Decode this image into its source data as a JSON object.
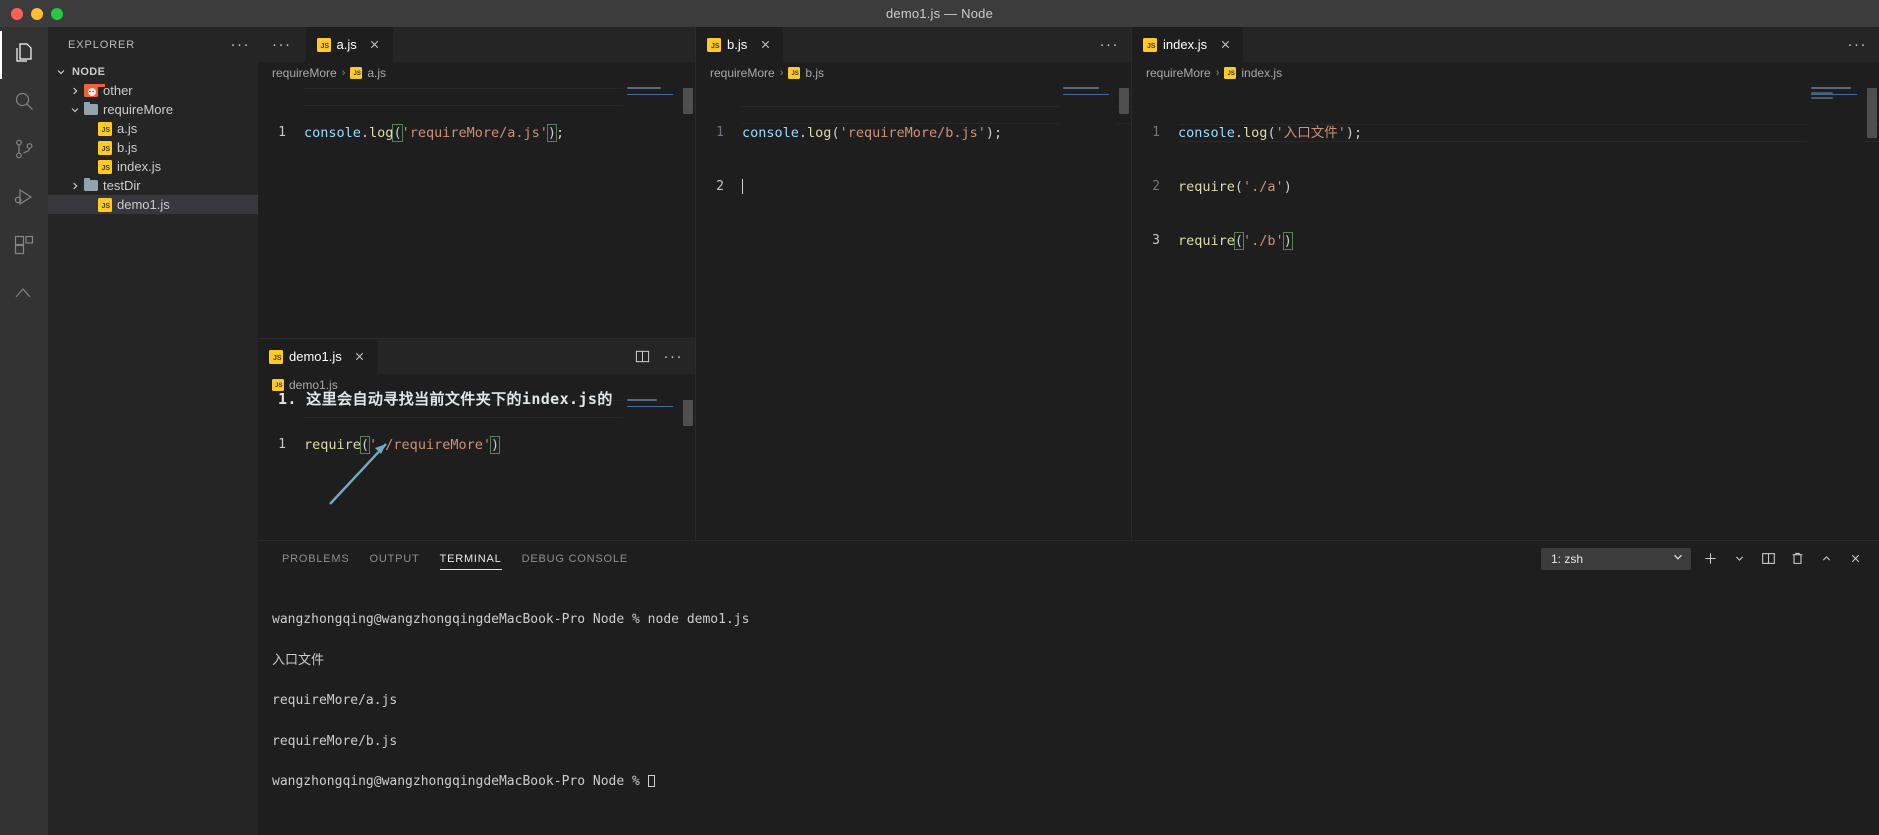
{
  "window": {
    "title": "demo1.js — Node",
    "traffic_lights": [
      "close",
      "minimize",
      "zoom"
    ]
  },
  "activity_bar": {
    "items": [
      {
        "name": "explorer",
        "icon": "files-icon",
        "active": true
      },
      {
        "name": "search",
        "icon": "search-icon",
        "active": false
      },
      {
        "name": "source-control",
        "icon": "source-control-icon",
        "active": false
      },
      {
        "name": "run-and-debug",
        "icon": "run-debug-icon",
        "active": false
      },
      {
        "name": "extensions",
        "icon": "extensions-icon",
        "active": false
      },
      {
        "name": "remote-explorer",
        "icon": "remote-icon",
        "active": false
      }
    ]
  },
  "sidebar": {
    "header": {
      "title": "EXPLORER",
      "more_actions": "···"
    },
    "tree": [
      {
        "label": "NODE",
        "type": "root",
        "expanded": true,
        "indent": 0,
        "icon": "chevron-down-icon"
      },
      {
        "label": "other",
        "type": "folder",
        "expanded": false,
        "indent": 1,
        "icon": "folder-red-icon"
      },
      {
        "label": "requireMore",
        "type": "folder",
        "expanded": true,
        "indent": 1,
        "icon": "folder-blue-icon"
      },
      {
        "label": "a.js",
        "type": "file",
        "indent": 2,
        "icon": "js-file-icon"
      },
      {
        "label": "b.js",
        "type": "file",
        "indent": 2,
        "icon": "js-file-icon"
      },
      {
        "label": "index.js",
        "type": "file",
        "indent": 2,
        "icon": "js-file-icon"
      },
      {
        "label": "testDir",
        "type": "folder",
        "expanded": false,
        "indent": 1,
        "icon": "folder-blue-icon"
      },
      {
        "label": "demo1.js",
        "type": "file",
        "indent": 1,
        "icon": "js-file-icon",
        "selected": true
      }
    ]
  },
  "editors": {
    "a_js": {
      "tab": {
        "label": "a.js",
        "icon": "js-file-icon",
        "close": "close-icon",
        "active": true
      },
      "more_actions": "···",
      "breadcrumb": {
        "folder": "requireMore",
        "separator": "›",
        "file": "a.js"
      },
      "lines": [
        {
          "number": "1",
          "tokens": [
            {
              "text": "console",
              "cls": "t-obj"
            },
            {
              "text": ".",
              "cls": "t-punc"
            },
            {
              "text": "log",
              "cls": "t-fn"
            },
            {
              "text": "(",
              "cls": "t-paren-hl"
            },
            {
              "text": "'requireMore/a.js'",
              "cls": "t-str"
            },
            {
              "text": ")",
              "cls": "t-paren-hl"
            },
            {
              "text": ";",
              "cls": "t-punc"
            }
          ]
        }
      ]
    },
    "b_js": {
      "tab": {
        "label": "b.js",
        "icon": "js-file-icon",
        "close": "close-icon",
        "active": true
      },
      "more_actions": "···",
      "breadcrumb": {
        "folder": "requireMore",
        "separator": "›",
        "file": "b.js"
      },
      "lines": [
        {
          "number": "1",
          "tokens": [
            {
              "text": "console",
              "cls": "t-obj"
            },
            {
              "text": ".",
              "cls": "t-punc"
            },
            {
              "text": "log",
              "cls": "t-fn"
            },
            {
              "text": "(",
              "cls": "t-punc"
            },
            {
              "text": "'requireMore/b.js'",
              "cls": "t-str"
            },
            {
              "text": ")",
              "cls": "t-punc"
            },
            {
              "text": ";",
              "cls": "t-punc"
            }
          ]
        },
        {
          "number": "2",
          "tokens": [],
          "current": true
        }
      ]
    },
    "index_js": {
      "tab": {
        "label": "index.js",
        "icon": "js-file-icon",
        "close": "close-icon",
        "active": true
      },
      "more_actions": "···",
      "breadcrumb": {
        "folder": "requireMore",
        "separator": "›",
        "file": "index.js"
      },
      "lines": [
        {
          "number": "1",
          "tokens": [
            {
              "text": "console",
              "cls": "t-obj"
            },
            {
              "text": ".",
              "cls": "t-punc"
            },
            {
              "text": "log",
              "cls": "t-fn"
            },
            {
              "text": "(",
              "cls": "t-punc"
            },
            {
              "text": "'入口文件'",
              "cls": "t-str"
            },
            {
              "text": ")",
              "cls": "t-punc"
            },
            {
              "text": ";",
              "cls": "t-punc"
            }
          ]
        },
        {
          "number": "2",
          "tokens": [
            {
              "text": "require",
              "cls": "t-fn"
            },
            {
              "text": "(",
              "cls": "t-punc"
            },
            {
              "text": "'./a'",
              "cls": "t-str"
            },
            {
              "text": ")",
              "cls": "t-punc"
            }
          ]
        },
        {
          "number": "3",
          "current": true,
          "tokens": [
            {
              "text": "require",
              "cls": "t-fn"
            },
            {
              "text": "(",
              "cls": "t-paren-hl"
            },
            {
              "text": "'./b'",
              "cls": "t-str"
            },
            {
              "text": ")",
              "cls": "t-paren-hl"
            }
          ]
        }
      ]
    },
    "demo1_js": {
      "tab": {
        "label": "demo1.js",
        "icon": "js-file-icon",
        "close": "close-icon",
        "active": true
      },
      "split_editor": "split-editor-icon",
      "more_actions": "···",
      "breadcrumb": {
        "folder": "",
        "separator": "",
        "file": "demo1.js"
      },
      "lines": [
        {
          "number": "1",
          "current": true,
          "tokens": [
            {
              "text": "require",
              "cls": "t-fn"
            },
            {
              "text": "(",
              "cls": "t-paren-hl"
            },
            {
              "text": "'./requireMore'",
              "cls": "t-str"
            },
            {
              "text": ")",
              "cls": "t-paren-hl"
            }
          ]
        }
      ],
      "annotation": {
        "text": "1. 这里会自动寻找当前文件夹下的index.js的",
        "arrow_color": "#74a9c4"
      }
    }
  },
  "panel": {
    "tabs": [
      {
        "label": "PROBLEMS",
        "active": false
      },
      {
        "label": "OUTPUT",
        "active": false
      },
      {
        "label": "TERMINAL",
        "active": true
      },
      {
        "label": "DEBUG CONSOLE",
        "active": false
      }
    ],
    "terminal_selector": {
      "value": "1: zsh",
      "chevron": "chevron-down-icon"
    },
    "actions": [
      {
        "name": "new-terminal",
        "icon": "plus-icon"
      },
      {
        "name": "new-terminal-profile",
        "icon": "chevron-down-icon"
      },
      {
        "name": "split-terminal",
        "icon": "split-icon"
      },
      {
        "name": "kill-terminal",
        "icon": "trash-icon"
      },
      {
        "name": "maximize-panel",
        "icon": "chevron-up-icon"
      },
      {
        "name": "close-panel",
        "icon": "close-icon"
      }
    ],
    "terminal_output": [
      "wangzhongqing@wangzhongqingdeMacBook-Pro Node % node demo1.js",
      "入口文件",
      "requireMore/a.js",
      "requireMore/b.js"
    ],
    "prompt": "wangzhongqing@wangzhongqingdeMacBook-Pro Node % "
  },
  "theme": {
    "editor_bg": "#1e1e1e",
    "sidebar_bg": "#252526",
    "activitybar_bg": "#333333",
    "titlebar_bg": "#3c3c3c",
    "accent_string": "#CE9178",
    "accent_function": "#DCDCAA",
    "accent_variable": "#9CDCFE",
    "selection_bg": "#37373d"
  }
}
